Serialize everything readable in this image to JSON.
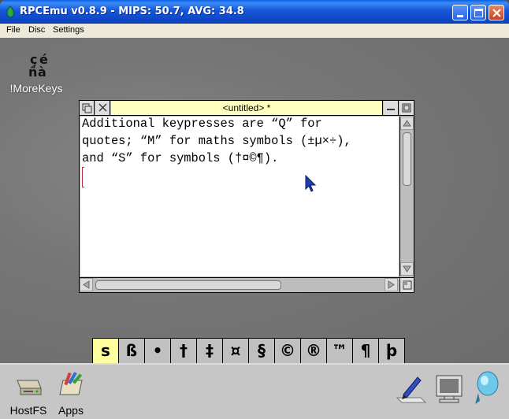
{
  "window": {
    "title": "RPCEmu v0.8.9 - MIPS: 50.7, AVG: 34.8"
  },
  "menu": [
    "File",
    "Disc",
    "Settings"
  ],
  "pinboard": {
    "morekeys_label": "!MoreKeys"
  },
  "editor": {
    "title": "<untitled> *",
    "lines": [
      "Additional keypresses are “Q” for",
      "quotes; “M” for maths symbols (±µ×÷),",
      "and “S” for symbols (†¤©¶)."
    ]
  },
  "symbol_bar": {
    "keys": [
      "s",
      "ß",
      "•",
      "†",
      "‡",
      "¤",
      "§",
      "©",
      "®",
      "™",
      "¶",
      "þ"
    ],
    "active_index": 0
  },
  "iconbar": {
    "hostfs_label": "HostFS",
    "apps_label": "Apps"
  },
  "colors": {
    "xp_title_blue": "#1656d8",
    "riscos_title_yellow": "#ffffc0",
    "symbol_active": "#ffffa0",
    "pointer_blue": "#1a3fb0"
  }
}
